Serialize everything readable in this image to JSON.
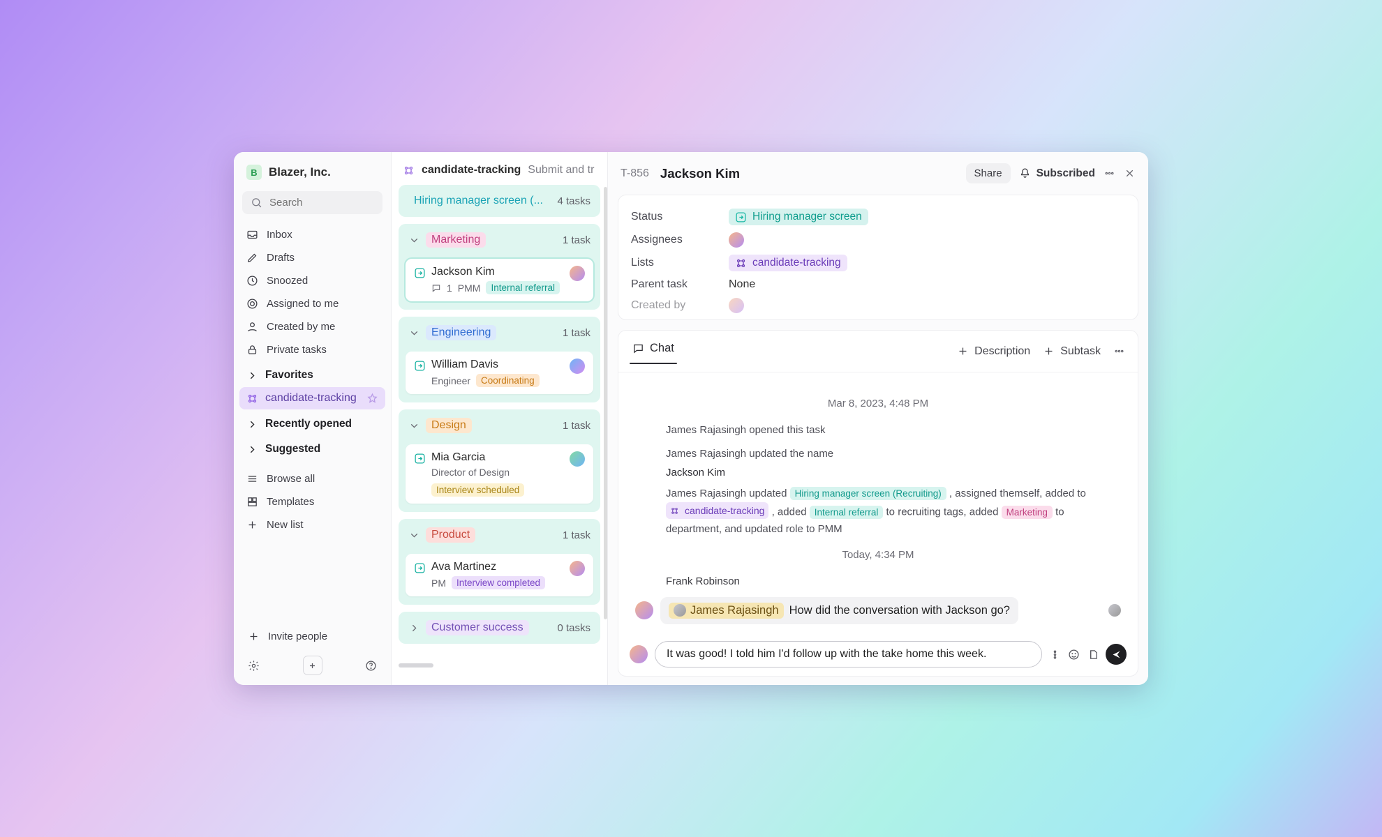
{
  "workspace": {
    "name": "Blazer, Inc.",
    "initial": "B"
  },
  "search_placeholder": "Search",
  "nav": {
    "inbox": "Inbox",
    "drafts": "Drafts",
    "snoozed": "Snoozed",
    "assigned": "Assigned to me",
    "created": "Created by me",
    "private": "Private tasks"
  },
  "sections": {
    "favorites": "Favorites",
    "recently": "Recently opened",
    "suggested": "Suggested"
  },
  "fav_list": "candidate-tracking",
  "utility": {
    "browse": "Browse all",
    "templates": "Templates",
    "newlist": "New list",
    "invite": "Invite people"
  },
  "listcol": {
    "name": "candidate-tracking",
    "crumb": "Submit and tr",
    "top_group": "Hiring manager screen (...",
    "top_count": "4 tasks",
    "groups": [
      {
        "title": "Marketing",
        "tagClass": "pink",
        "count": "1 task",
        "cards": [
          {
            "name": "Jackson Kim",
            "role": "PMM",
            "tag": "Internal referral",
            "tagClass": "teal",
            "comments": "1",
            "sel": true
          }
        ]
      },
      {
        "title": "Engineering",
        "tagClass": "blue",
        "count": "1 task",
        "cards": [
          {
            "name": "William Davis",
            "role": "Engineer",
            "tag": "Coordinating",
            "tagClass": "orange"
          }
        ]
      },
      {
        "title": "Design",
        "tagClass": "orange",
        "count": "1 task",
        "cards": [
          {
            "name": "Mia Garcia",
            "role": "Director of Design",
            "tag": "Interview scheduled",
            "tagClass": "yellow"
          }
        ]
      },
      {
        "title": "Product",
        "tagClass": "red",
        "count": "1 task",
        "cards": [
          {
            "name": "Ava Martinez",
            "role": "PM",
            "tag": "Interview completed",
            "tagClass": "purple"
          }
        ]
      },
      {
        "title": "Customer success",
        "tagClass": "lpurple",
        "count": "0 tasks",
        "collapsed": true,
        "cards": []
      }
    ]
  },
  "detail": {
    "id": "T-856",
    "title": "Jackson Kim",
    "share": "Share",
    "subscribed": "Subscribed",
    "meta": {
      "status_label": "Status",
      "status_value": "Hiring manager screen",
      "assignees_label": "Assignees",
      "lists_label": "Lists",
      "lists_value": "candidate-tracking",
      "parent_label": "Parent task",
      "parent_value": "None",
      "created_label": "Created by"
    },
    "tabs": {
      "chat": "Chat",
      "description": "Description",
      "subtask": "Subtask"
    },
    "feed": {
      "ts1": "Mar 8, 2023, 4:48 PM",
      "e1": "James Rajasingh opened this task",
      "e2": "James Rajasingh updated the name",
      "e2b": "Jackson Kim",
      "e3_pre": "James Rajasingh updated ",
      "e3_stage": "Hiring manager screen (Recruiting)",
      "e3_mid": " , assigned themself, added to ",
      "e3_list": "candidate-tracking",
      "e3_mid2": " , added ",
      "e3_tag": "Internal referral",
      "e3_mid3": " to recruiting tags, added ",
      "e3_dept": "Marketing",
      "e3_end": " to department, and updated role to PMM",
      "ts2": "Today, 4:34 PM",
      "sender": "Frank Robinson",
      "mention": "James Rajasingh",
      "msg": "How did the conversation with Jackson go?",
      "compose": "It was good! I told him I'd follow up with the take home this week."
    }
  }
}
